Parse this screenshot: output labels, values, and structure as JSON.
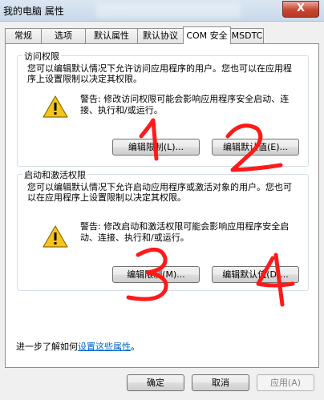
{
  "window": {
    "title": "我的电脑 属性",
    "close_glyph": "X"
  },
  "tabs": [
    {
      "label": "常规",
      "active": false
    },
    {
      "label": "选项",
      "active": false
    },
    {
      "label": "默认属性",
      "active": false
    },
    {
      "label": "默认协议",
      "active": false
    },
    {
      "label": "COM 安全",
      "active": true
    },
    {
      "label": "MSDTC",
      "active": false
    }
  ],
  "access": {
    "legend": "访问权限",
    "description": "您可以编辑默认情况下允许访问应用程序的用户。您也可以在应用程序上设置限制以决定其权限。",
    "warning": "警告: 修改访问权限可能会影响应用程序安全启动、连接、执行和/或运行。",
    "edit_limits_button": "编辑限制(L)...",
    "edit_default_button": "编辑默认值(E)..."
  },
  "launch": {
    "legend": "启动和激活权限",
    "description": "您可以编辑默认情况下允许启动应用程序或激活对象的用户。您也可以在应用程序上设置限制以决定其权限。",
    "warning": "警告: 修改启动和激活权限可能会影响应用程序安全启动、连接、执行和/或运行。",
    "edit_limits_button": "编辑限制(M)...",
    "edit_default_button": "编辑默认值(D)..."
  },
  "footer": {
    "prefix": "进一步了解如何",
    "link": "设置这些属性",
    "suffix": "。"
  },
  "buttons": {
    "ok": "确定",
    "cancel": "取消",
    "apply": "应用(A)"
  },
  "annotations": {
    "color": "#ff1a1a",
    "marks": [
      "1",
      "2",
      "3",
      "4"
    ]
  }
}
